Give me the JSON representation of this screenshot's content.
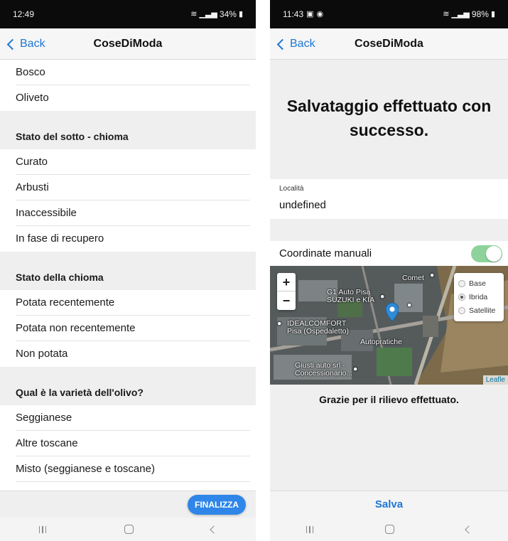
{
  "left": {
    "status": {
      "time": "12:49",
      "battery": "34%"
    },
    "nav": {
      "back_label": "Back",
      "title": "CoseDiModa"
    },
    "items_top": [
      "Bosco",
      "Oliveto"
    ],
    "sections": [
      {
        "header": "Stato del sotto - chioma",
        "items": [
          "Curato",
          "Arbusti",
          "Inaccessibile",
          "In fase di recupero"
        ]
      },
      {
        "header": "Stato della chioma",
        "items": [
          "Potata recentemente",
          "Potata non recentemente",
          "Non potata"
        ]
      },
      {
        "header": "Qual è la varietà dell'olivo?",
        "items": [
          "Seggianese",
          "Altre toscane",
          "Misto (seggianese e toscane)"
        ]
      }
    ],
    "finalize_label": "FINALIZZA"
  },
  "right": {
    "status": {
      "time": "11:43",
      "battery": "98%"
    },
    "nav": {
      "back_label": "Back",
      "title": "CoseDiModa"
    },
    "success_message": "Salvataggio effettuato con successo.",
    "location": {
      "label": "Località",
      "value": "undefined"
    },
    "manual_coords": {
      "label": "Coordinate manuali",
      "enabled": true
    },
    "map": {
      "zoom_in": "+",
      "zoom_out": "−",
      "layers": [
        {
          "label": "Base",
          "selected": false
        },
        {
          "label": "Ibrida",
          "selected": true
        },
        {
          "label": "Satellite",
          "selected": false
        }
      ],
      "labels": {
        "comet": "Comet",
        "g1_line1": "G1 Auto Pisa",
        "g1_line2": "SUZUKI e KIA",
        "ideal_line1": "IDEALCOMFORT",
        "ideal_line2": "Pisa (Ospedaletto)",
        "autopratiche": "Autopratiche",
        "giusti_line1": "Giusti auto srl -",
        "giusti_line2": "Concessionario..."
      },
      "attribution": "Leafle"
    },
    "thanks_message": "Grazie per il rilievo effettuato.",
    "save_label": "Salva"
  },
  "colors": {
    "accent": "#1d76d6",
    "toggle_on": "#8fd39c",
    "button": "#2f86e8",
    "section_bg": "#efefef"
  }
}
